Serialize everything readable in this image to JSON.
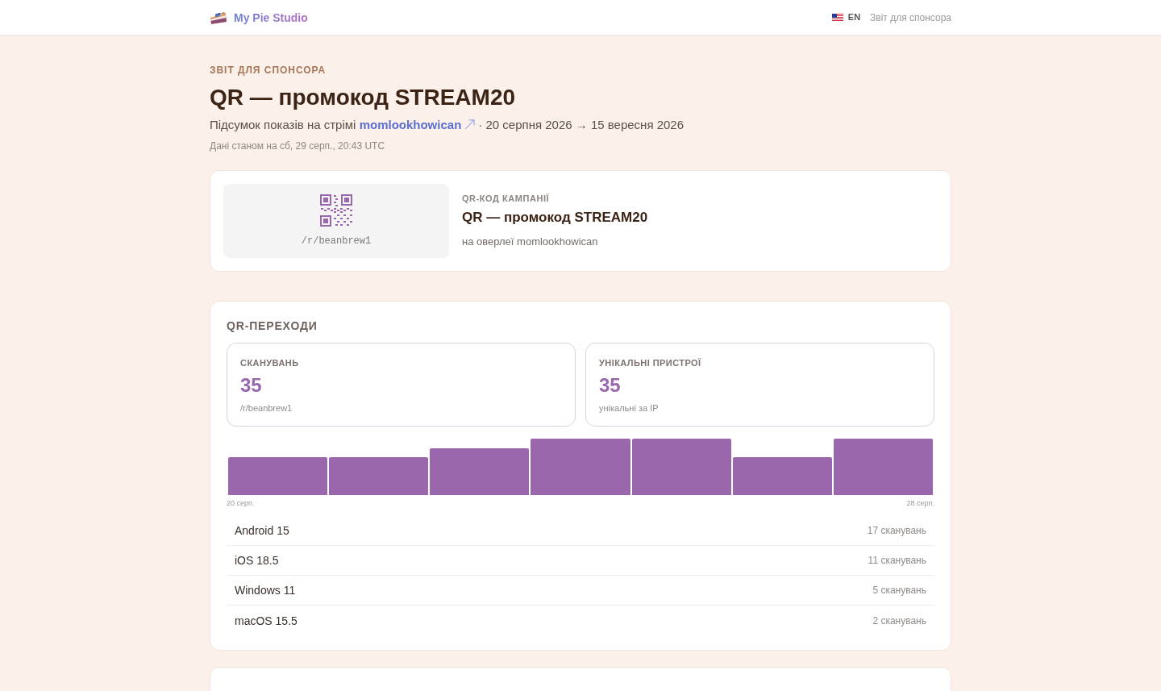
{
  "header": {
    "brand": "My Pie Studio",
    "language": "EN",
    "page_label": "Звіт для спонсора"
  },
  "report": {
    "eyebrow": "ЗВІТ ДЛЯ СПОНСОРА",
    "title": "QR — промокод STREAM20",
    "summary_prefix": "Підсумок показів на стрімі",
    "channel_link": "momlookhowican",
    "date_range": "· 20 серпня 2026 → 15 вересня 2026",
    "data_as_of": "Дані станом на сб, 29 серп., 20:43 UTC"
  },
  "campaign_card": {
    "qr_path": "/r/beanbrew1",
    "eyebrow": "QR-КОД КАМПАНІЇ",
    "title": "QR — промокод STREAM20",
    "note": "на оверлеї momlookhowican"
  },
  "qr_section": {
    "title": "QR-ПЕРЕХОДИ",
    "stats": [
      {
        "label": "СКАНУВАНЬ",
        "value": "35",
        "note": "/r/beanbrew1"
      },
      {
        "label": "УНІКАЛЬНІ ПРИСТРОЇ",
        "value": "35",
        "note": "унікальні за IP"
      }
    ],
    "chart": {
      "start_label": "20 серп.",
      "end_label": "28 серп."
    },
    "devices": [
      {
        "name": "Android 15",
        "count": "17 сканувань"
      },
      {
        "name": "iOS 18.5",
        "count": "11 сканувань"
      },
      {
        "name": "Windows 11",
        "count": "5 сканувань"
      },
      {
        "name": "macOS 15.5",
        "count": "2 сканувань"
      }
    ]
  }
}
